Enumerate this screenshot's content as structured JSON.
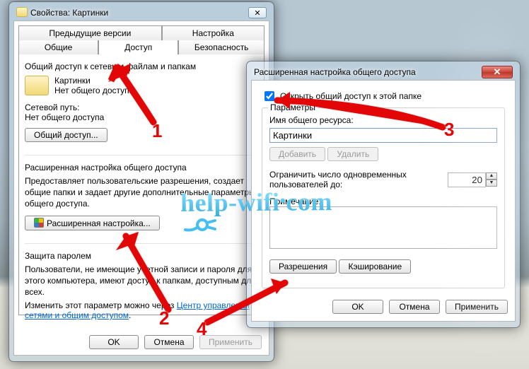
{
  "win1": {
    "title": "Свойства: Картинки",
    "tabs_row1": [
      "Предыдущие версии",
      "Настройка"
    ],
    "tabs_row2": [
      "Общие",
      "Доступ",
      "Безопасность"
    ],
    "active_tab": "Доступ",
    "share": {
      "heading": "Общий доступ к сетевым файлам и папкам",
      "folder_name": "Картинки",
      "status": "Нет общего доступа",
      "netpath_label": "Сетевой путь:",
      "netpath_value": "Нет общего доступа",
      "share_btn": "Общий доступ..."
    },
    "advanced": {
      "heading": "Расширенная настройка общего доступа",
      "desc": "Предоставляет пользовательские разрешения, создает общие папки и задает другие дополнительные параметры общего доступа.",
      "btn": "Расширенная настройка..."
    },
    "pwd": {
      "heading": "Защита паролем",
      "desc": "Пользователи, не имеющие учетной записи и пароля для этого компьютера, имеют доступ к папкам, доступным для всех.",
      "change_prefix": "Изменить этот параметр можно через ",
      "link": "Центр управления сетями и общим доступом",
      "link_suffix": "."
    },
    "footer": {
      "ok": "OK",
      "cancel": "Отмена",
      "apply": "Применить"
    }
  },
  "win2": {
    "title": "Расширенная настройка общего доступа",
    "chk_label": "Открыть общий доступ к этой папке",
    "chk_checked": true,
    "fieldset_legend": "Параметры",
    "resname_label": "Имя общего ресурса:",
    "resname_value": "Картинки",
    "add_btn": "Добавить",
    "remove_btn": "Удалить",
    "limit_label": "Ограничить число одновременных пользователей до:",
    "limit_value": "20",
    "note_label": "Примечание:",
    "note_value": "",
    "perms_btn": "Разрешения",
    "cache_btn": "Кэширование",
    "footer": {
      "ok": "OK",
      "cancel": "Отмена",
      "apply": "Применить"
    }
  },
  "annotations": {
    "n1": "1",
    "n2": "2",
    "n3": "3",
    "n4": "4"
  },
  "watermark": "help-wifi com"
}
